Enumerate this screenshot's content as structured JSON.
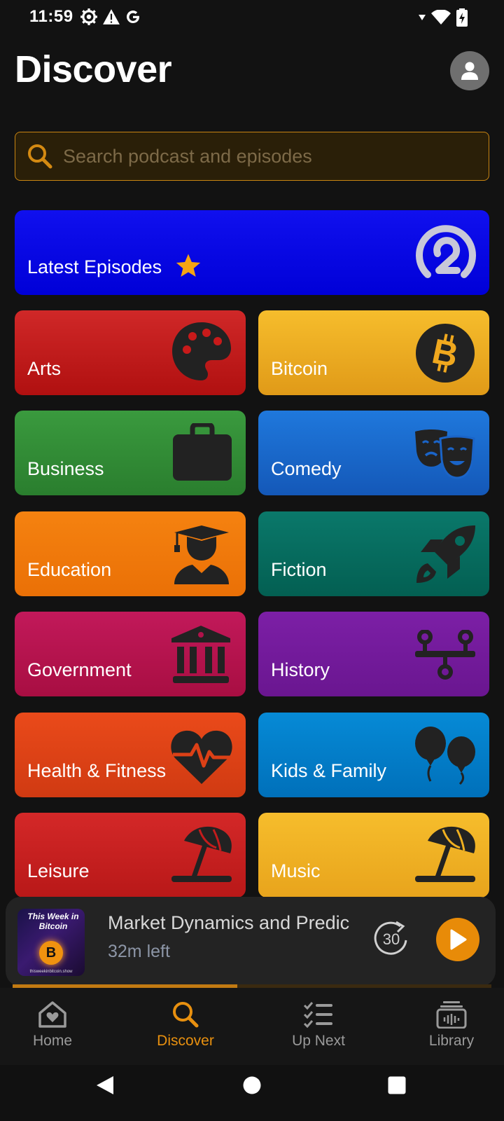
{
  "status_bar": {
    "time": "11:59",
    "left_icons": [
      "settings-icon",
      "warning-icon",
      "google-icon"
    ],
    "right_icons": [
      "signal-icon",
      "wifi-icon",
      "battery-charging-icon"
    ]
  },
  "header": {
    "title": "Discover",
    "avatar_icon": "person-icon"
  },
  "search": {
    "placeholder": "Search podcast and episodes",
    "value": "",
    "icon": "search-icon"
  },
  "featured": {
    "label": "Latest Episodes",
    "badge_icon": "star-icon",
    "icon": "podcast-logo-icon",
    "color": "#0a08e8"
  },
  "categories": [
    {
      "label": "Arts",
      "icon": "palette-icon",
      "color": "#c8181c"
    },
    {
      "label": "Bitcoin",
      "icon": "bitcoin-icon",
      "color": "#f0b020"
    },
    {
      "label": "Business",
      "icon": "briefcase-icon",
      "color": "#2e8a32"
    },
    {
      "label": "Comedy",
      "icon": "theater-masks-icon",
      "color": "#1a6ad0"
    },
    {
      "label": "Education",
      "icon": "graduate-icon",
      "color": "#f07a08"
    },
    {
      "label": "Fiction",
      "icon": "rocket-icon",
      "color": "#046c5c"
    },
    {
      "label": "Government",
      "icon": "government-building-icon",
      "color": "#c0144e"
    },
    {
      "label": "History",
      "icon": "timeline-icon",
      "color": "#7a1aa0"
    },
    {
      "label": "Health & Fitness",
      "icon": "heartbeat-icon",
      "color": "#e8461a"
    },
    {
      "label": "Kids & Family",
      "icon": "balloons-icon",
      "color": "#0080cc"
    },
    {
      "label": "Leisure",
      "icon": "beach-umbrella-icon",
      "color": "#d02020"
    },
    {
      "label": "Music",
      "icon": "beach-umbrella-icon",
      "color": "#f0b020"
    }
  ],
  "player": {
    "artwork_title": "This Week in Bitcoin",
    "artwork_url": "thisweekinbitcoin.show",
    "episode_title": "Market Dynamics and Predic",
    "time_left": "32m left",
    "skip_label": "30",
    "progress": 0.47,
    "accent_color": "#e88b08"
  },
  "bottom_nav": [
    {
      "label": "Home",
      "icon": "home-heart-icon",
      "active": false
    },
    {
      "label": "Discover",
      "icon": "search-icon",
      "active": true
    },
    {
      "label": "Up Next",
      "icon": "checklist-icon",
      "active": false
    },
    {
      "label": "Library",
      "icon": "library-icon",
      "active": false
    }
  ],
  "system_nav": [
    "back-icon",
    "home-circle-icon",
    "recents-icon"
  ]
}
